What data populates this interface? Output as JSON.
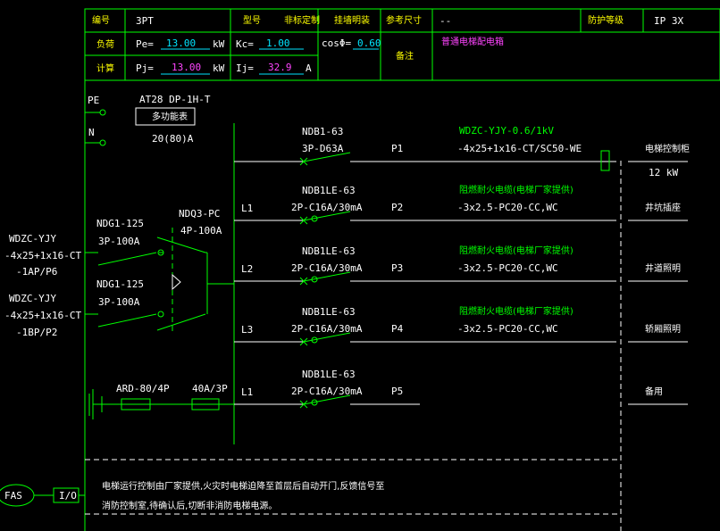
{
  "header": {
    "label_number": "编号",
    "number": "3PT",
    "label_model": "型号",
    "model_values": [
      "非标定制",
      "挂墙明装"
    ],
    "label_ref_size": "参考尺寸",
    "ref_size": "--",
    "label_protection": "防护等级",
    "protection": "IP 3X",
    "label_load": "负荷",
    "label_calc": "计算",
    "pe_label": "Pe=",
    "pe_value": "13.00",
    "pe_unit": "kW",
    "pj_label": "Pj=",
    "pj_value": "13.00",
    "pj_unit": "kW",
    "kc_label": "Kc=",
    "kc_value": "1.00",
    "ij_label": "Ij=",
    "ij_value": "32.9",
    "ij_unit": "A",
    "cos_label": "cosΦ=",
    "cos_value": "0.60",
    "remark_label": "备注",
    "remark_value": "普通电梯配电箱"
  },
  "bus": {
    "pe": "PE",
    "n": "N",
    "breaker_model": "AT28 DP-1H-T",
    "breaker_box": "多功能表",
    "breaker_rating": "20(80)A"
  },
  "incoming": [
    {
      "l1": "WDZC-YJY",
      "l2": "-4x25+1x16-CT",
      "l3": "-1AP/P6",
      "switch1": "NDG1-125",
      "switch2": "3P-100A"
    },
    {
      "l1": "WDZC-YJY",
      "l2": "-4x25+1x16-CT",
      "l3": "-1BP/P2",
      "switch1": "NDG1-125",
      "switch2": "3P-100A"
    }
  ],
  "ats": {
    "model": "NDQ3-PC",
    "rating": "4P-100A"
  },
  "circuits": [
    {
      "phase": "",
      "breaker": "NDB1-63",
      "rating": "3P-D63A",
      "id": "P1",
      "cable_top": "WDZC-YJY-0.6/1kV",
      "cable": "-4x25+1x16-CT/SC50-WE",
      "load": "电梯控制柜",
      "load2": "12 kW"
    },
    {
      "phase": "L1",
      "breaker": "NDB1LE-63",
      "rating": "2P-C16A/30mA",
      "id": "P2",
      "cable_top": "阻燃耐火电缆(电梯厂家提供)",
      "cable": "-3x2.5-PC20-CC,WC",
      "load": "井坑插座",
      "load2": ""
    },
    {
      "phase": "L2",
      "breaker": "NDB1LE-63",
      "rating": "2P-C16A/30mA",
      "id": "P3",
      "cable_top": "阻燃耐火电缆(电梯厂家提供)",
      "cable": "-3x2.5-PC20-CC,WC",
      "load": "井道照明",
      "load2": ""
    },
    {
      "phase": "L3",
      "breaker": "NDB1LE-63",
      "rating": "2P-C16A/30mA",
      "id": "P4",
      "cable_top": "阻燃耐火电缆(电梯厂家提供)",
      "cable": "-3x2.5-PC20-CC,WC",
      "load": "轿厢照明",
      "load2": ""
    },
    {
      "phase": "L1",
      "breaker": "NDB1LE-63",
      "rating": "2P-C16A/30mA",
      "id": "P5",
      "cable_top": "",
      "cable": "",
      "load": "备用",
      "load2": ""
    }
  ],
  "spd": {
    "model": "ARD-80/4P",
    "fuse": "40A/3P"
  },
  "fas": {
    "label": "FAS",
    "io": "I/O"
  },
  "note": {
    "line1": "电梯运行控制由厂家提供,火灾时电梯迫降至首层后自动开门,反馈信号至",
    "line2": "消防控制室,待确认后,切断非消防电梯电源。"
  }
}
